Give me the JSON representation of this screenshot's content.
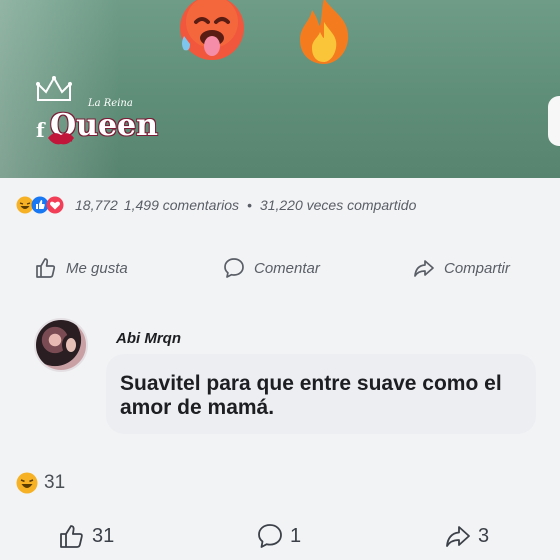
{
  "post": {
    "logo": {
      "script_text": "La Reina",
      "word": "Queen",
      "word_prefix": "f"
    },
    "emojis": [
      "hot-face-icon",
      "fire-icon"
    ]
  },
  "stats": {
    "reaction_count": "18,772",
    "comments": "1,499 comentarios",
    "separator": "•",
    "shares": "31,220 veces compartido"
  },
  "actions": {
    "like_label": "Me gusta",
    "comment_label": "Comentar",
    "share_label": "Compartir"
  },
  "comment": {
    "author": "Abi Mrqn",
    "text": "Suavitel para que entre suave como el amor de mamá.",
    "reaction_count": "31"
  },
  "bottom_bar": {
    "likes": "31",
    "comments": "1",
    "shares": "3"
  },
  "colors": {
    "post_bg": "#5f8e78",
    "muted_text": "#5a5e66",
    "bubble_bg": "#edeef2",
    "haha": "#f7b125",
    "like_blue": "#1877f2",
    "love_red": "#f33e58"
  }
}
